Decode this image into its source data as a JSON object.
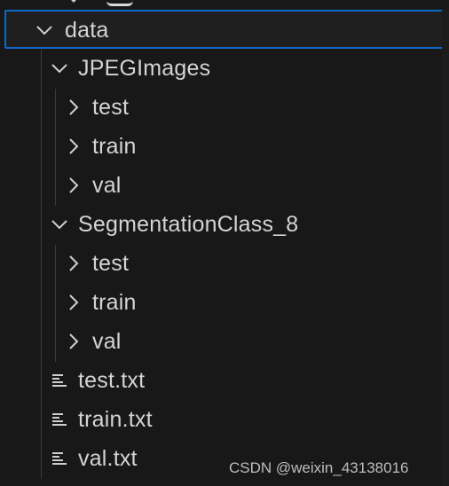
{
  "tree": {
    "root": {
      "label": "data",
      "expanded": true,
      "selected": true
    },
    "jpeg_folder": {
      "label": "JPEGImages",
      "expanded": true,
      "children": [
        "test",
        "train",
        "val"
      ]
    },
    "seg_folder": {
      "label": "SegmentationClass_8",
      "expanded": true,
      "children": [
        "test",
        "train",
        "val"
      ]
    },
    "files": [
      "test.txt",
      "train.txt",
      "val.txt"
    ]
  },
  "watermark": "CSDN @weixin_43138016",
  "colors": {
    "background": "#181818",
    "selection_border": "#0a69c9",
    "text": "#d4d4d4",
    "indent_guide": "#3c3c3c"
  },
  "icons": {
    "expanded": "chevron-down-icon",
    "collapsed": "chevron-right-icon",
    "file": "text-file-icon"
  }
}
